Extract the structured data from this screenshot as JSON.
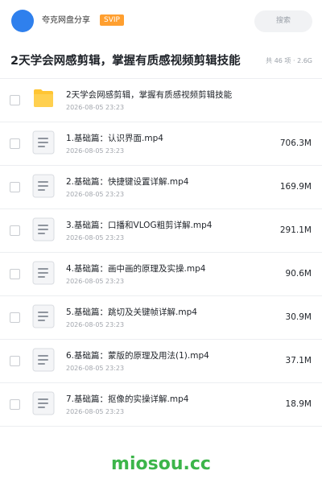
{
  "header": {
    "share_name": "夸克网盘分享",
    "badge": "SVIP",
    "search_placeholder": "搜索",
    "avatar_color": "#2f80ed",
    "badge_color": "#ff9f2f"
  },
  "title_row": {
    "title": "2天学会网感剪辑，掌握有质感视频剪辑技能",
    "meta": "共 46 项 · 2.6G"
  },
  "files": [
    {
      "name": "2天学会网感剪辑，掌握有质感视频剪辑技能",
      "date": "2026-08-05 23:23",
      "size": "",
      "icon": "folder-icon"
    },
    {
      "name": "1.基础篇：认识界面.mp4",
      "date": "2026-08-05 23:23",
      "size": "706.3M",
      "icon": "file-icon"
    },
    {
      "name": "2.基础篇：快捷键设置详解.mp4",
      "date": "2026-08-05 23:23",
      "size": "169.9M",
      "icon": "file-icon"
    },
    {
      "name": "3.基础篇：口播和VLOG粗剪详解.mp4",
      "date": "2026-08-05 23:23",
      "size": "291.1M",
      "icon": "file-icon"
    },
    {
      "name": "4.基础篇：画中画的原理及实操.mp4",
      "date": "2026-08-05 23:23",
      "size": "90.6M",
      "icon": "file-icon"
    },
    {
      "name": "5.基础篇：跳切及关键帧详解.mp4",
      "date": "2026-08-05 23:23",
      "size": "30.9M",
      "icon": "file-icon"
    },
    {
      "name": "6.基础篇：蒙版的原理及用法(1).mp4",
      "date": "2026-08-05 23:23",
      "size": "37.1M",
      "icon": "file-icon"
    },
    {
      "name": "7.基础篇：抠像的实操详解.mp4",
      "date": "2026-08-05 23:23",
      "size": "18.9M",
      "icon": "file-icon"
    }
  ],
  "watermark": "miosou.cc",
  "colors": {
    "folder": "#ffc533",
    "watermark": "#3cb54a"
  }
}
